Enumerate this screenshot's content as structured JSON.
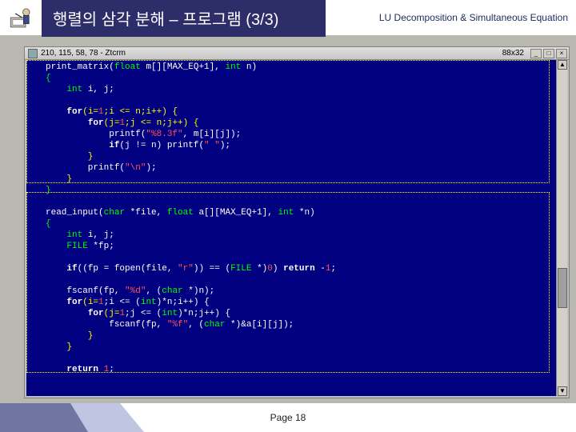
{
  "header": {
    "title": "행렬의 삼각 분해 – 프로그램 (3/3)",
    "subtitle": "LU Decomposition & Simultaneous Equation"
  },
  "window": {
    "title": "210, 115, 58, 78 - Ztcrm",
    "dim_label": "88x32",
    "buttons": {
      "min": "_",
      "max": "□",
      "close": "×"
    }
  },
  "code": {
    "l01a": "print_matrix(",
    "l01b": "float",
    "l01c": " m[][MAX_EQ+1], ",
    "l01d": "int",
    "l01e": " n)",
    "l02": "{",
    "l03a": "    ",
    "l03b": "int",
    "l03c": " i, j;",
    "l04": "",
    "l05a": "    ",
    "l05b": "for",
    "l05c": "(i=",
    "l05d": "1",
    "l05e": ";i <= n;i++) {",
    "l06a": "        ",
    "l06b": "for",
    "l06c": "(j=",
    "l06d": "1",
    "l06e": ";j <= n;j++) {",
    "l07a": "            printf(",
    "l07b": "\"%8.3f\"",
    "l07c": ", m[i][j]);",
    "l08a": "            ",
    "l08b": "if",
    "l08c": "(j != n) printf(",
    "l08d": "\" \"",
    "l08e": ");",
    "l09": "        }",
    "l10a": "        printf(",
    "l10b": "\"\\n\"",
    "l10c": ");",
    "l11": "    }",
    "l12": "}",
    "l13": "",
    "l14a": "read_input(",
    "l14b": "char",
    "l14c": " *file, ",
    "l14d": "float",
    "l14e": " a[][MAX_EQ+1], ",
    "l14f": "int",
    "l14g": " *n)",
    "l15": "{",
    "l16a": "    ",
    "l16b": "int",
    "l16c": " i, j;",
    "l17a": "    ",
    "l17b": "FILE",
    "l17c": " *fp;",
    "l18": "",
    "l19a": "    ",
    "l19b": "if",
    "l19c": "((fp = fopen(file, ",
    "l19d": "\"r\"",
    "l19e": ")) == (",
    "l19f": "FILE",
    "l19g": " *)",
    "l19h": "0",
    "l19i": ") ",
    "l19j": "return",
    "l19k": " -",
    "l19l": "1",
    "l19m": ";",
    "l20": "",
    "l21a": "    fscanf(fp, ",
    "l21b": "\"%d\"",
    "l21c": ", (",
    "l21d": "char",
    "l21e": " *)n);",
    "l22a": "    ",
    "l22b": "for",
    "l22c": "(i=",
    "l22d": "1",
    "l22e": ";i <= (",
    "l22f": "int",
    "l22g": ")*n;i++) {",
    "l23a": "        ",
    "l23b": "for",
    "l23c": "(j=",
    "l23d": "1",
    "l23e": ";j <= (",
    "l23f": "int",
    "l23g": ")*n;j++) {",
    "l24a": "            fscanf(fp, ",
    "l24b": "\"%f\"",
    "l24c": ", (",
    "l24d": "char",
    "l24e": " *)&a[i][j]);",
    "l25": "        }",
    "l26": "    }",
    "l27": "",
    "l28a": "    ",
    "l28b": "return",
    "l28c": " ",
    "l28d": "1",
    "l28e": ";"
  },
  "scrollbar": {
    "up": "▲",
    "down": "▼"
  },
  "footer": {
    "page": "Page 18"
  }
}
